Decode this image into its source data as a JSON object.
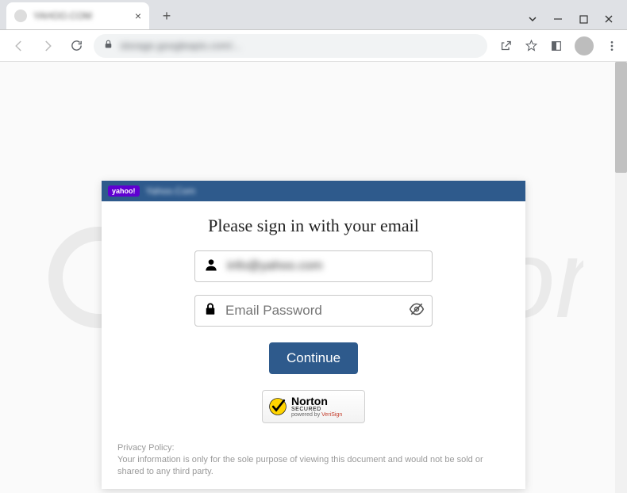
{
  "tab": {
    "title": "YAHOO.COM"
  },
  "url": "storage.googleapis.com/...",
  "card": {
    "header_badge": "yahoo!",
    "header_text": "Yahoo.Com",
    "title": "Please sign in with your email",
    "email_value": "info@yahoo.com",
    "password_placeholder": "Email Password",
    "continue_label": "Continue"
  },
  "norton": {
    "name": "Norton",
    "sub": "SECURED",
    "powered": "powered by ",
    "verisign": "VeriSign"
  },
  "privacy": {
    "heading": "Privacy Policy:",
    "body": "Your information is only for the sole purpose of viewing this document and would not be sold or shared to any third party."
  }
}
